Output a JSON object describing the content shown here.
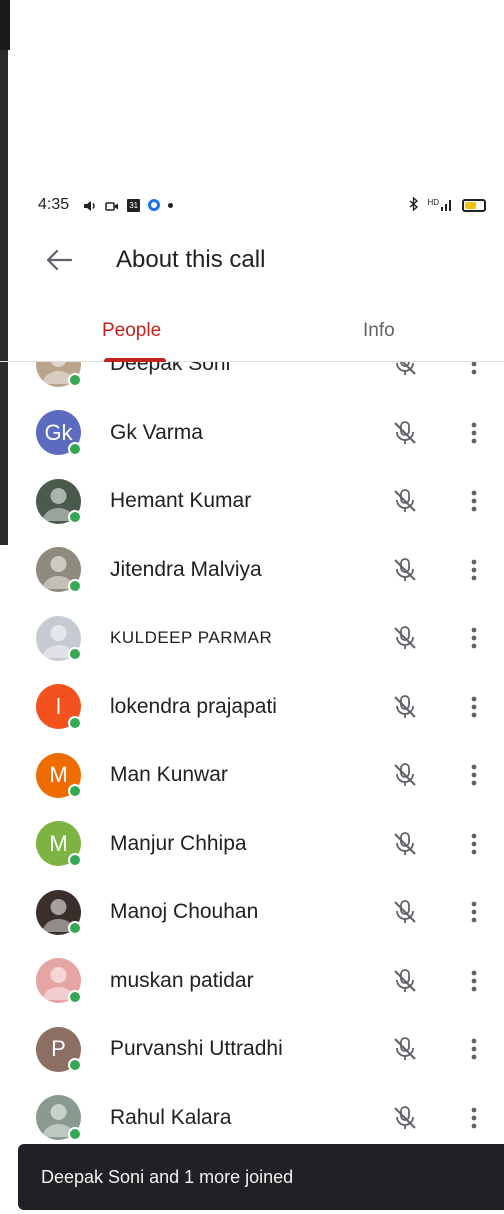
{
  "status_bar": {
    "time": "4:35",
    "calendar_day": "31",
    "signal_text": "HD",
    "left_icons": [
      "volume-icon",
      "video-icon",
      "calendar-icon",
      "meet-icon",
      "dot-icon"
    ],
    "right_icons": [
      "bluetooth-icon",
      "signal-icon",
      "battery-icon"
    ],
    "battery_level": 0.6,
    "battery_color": "#f4c20d"
  },
  "app_bar": {
    "title": "About this call",
    "back_icon": "arrow-back-icon"
  },
  "tabs": [
    {
      "label": "People",
      "active": true
    },
    {
      "label": "Info",
      "active": false
    }
  ],
  "colors": {
    "accent": "#c5221f",
    "presence": "#34a853",
    "snackbar_bg": "#202124"
  },
  "participants": [
    {
      "name": "Deepak Soni",
      "avatar": "photo",
      "initials": "",
      "color": "#b9a58c"
    },
    {
      "name": "Gk Varma",
      "avatar": "initials",
      "initials": "Gk",
      "color": "#5c6bc0"
    },
    {
      "name": "Hemant Kumar",
      "avatar": "photo",
      "initials": "",
      "color": "#4a5a4c"
    },
    {
      "name": "Jitendra Malviya",
      "avatar": "photo",
      "initials": "",
      "color": "#8e8a7e"
    },
    {
      "name": "KULDEEP PARMAR",
      "avatar": "photo",
      "initials": "",
      "color": "#c6cbd2"
    },
    {
      "name": "lokendra prajapati",
      "avatar": "initials",
      "initials": "l",
      "color": "#f4511e"
    },
    {
      "name": "Man Kunwar",
      "avatar": "initials",
      "initials": "M",
      "color": "#ef6c00"
    },
    {
      "name": "Manjur Chhipa",
      "avatar": "initials",
      "initials": "M",
      "color": "#7cb342"
    },
    {
      "name": "Manoj Chouhan",
      "avatar": "photo",
      "initials": "",
      "color": "#3a2f2b"
    },
    {
      "name": "muskan patidar",
      "avatar": "photo",
      "initials": "",
      "color": "#e6a5a5"
    },
    {
      "name": "Purvanshi Uttradhi",
      "avatar": "initials",
      "initials": "P",
      "color": "#8d6e63"
    },
    {
      "name": "Rahul Kalara",
      "avatar": "photo",
      "initials": "",
      "color": "#8a9a8e"
    }
  ],
  "row_icons": {
    "mic": "mic-off-icon",
    "more": "more-vert-icon"
  },
  "snackbar": {
    "message": "Deepak Soni and 1 more joined"
  }
}
